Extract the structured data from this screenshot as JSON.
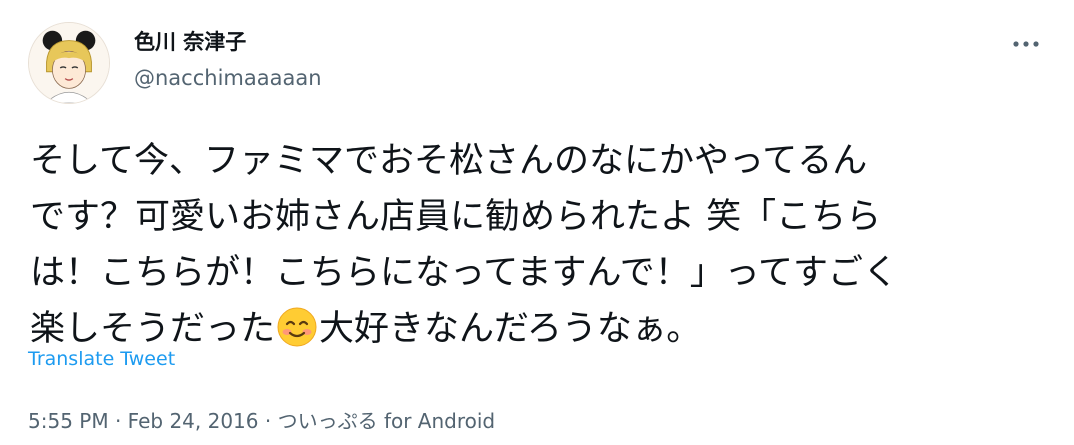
{
  "user": {
    "display_name": "色川 奈津子",
    "handle": "@nacchimaaaaan"
  },
  "tweet": {
    "lines": [
      "そして今、ファミマでおそ松さんのなにかやってるん",
      "です？可愛いお姉さん店員に勧められたよ 笑「こちら",
      "は！こちらが！こちらになってますんで！」ってすごく"
    ],
    "last_line_before_emoji": "楽しそうだった",
    "emoji_name": "smiling-face-with-smiling-eyes",
    "last_line_after_emoji": "大好きなんだろうなぁ。"
  },
  "actions": {
    "translate_label": "Translate Tweet"
  },
  "meta": {
    "time": "5:55 PM",
    "sep1": " · ",
    "date": "Feb 24, 2016",
    "sep2": " · ",
    "source": "ついっぷる for Android"
  },
  "icons": {
    "more": "more-horizontal-icon",
    "avatar": "avatar-illustration"
  },
  "colors": {
    "text_primary": "#0f1419",
    "text_secondary": "#536471",
    "link": "#1d9bf0"
  }
}
